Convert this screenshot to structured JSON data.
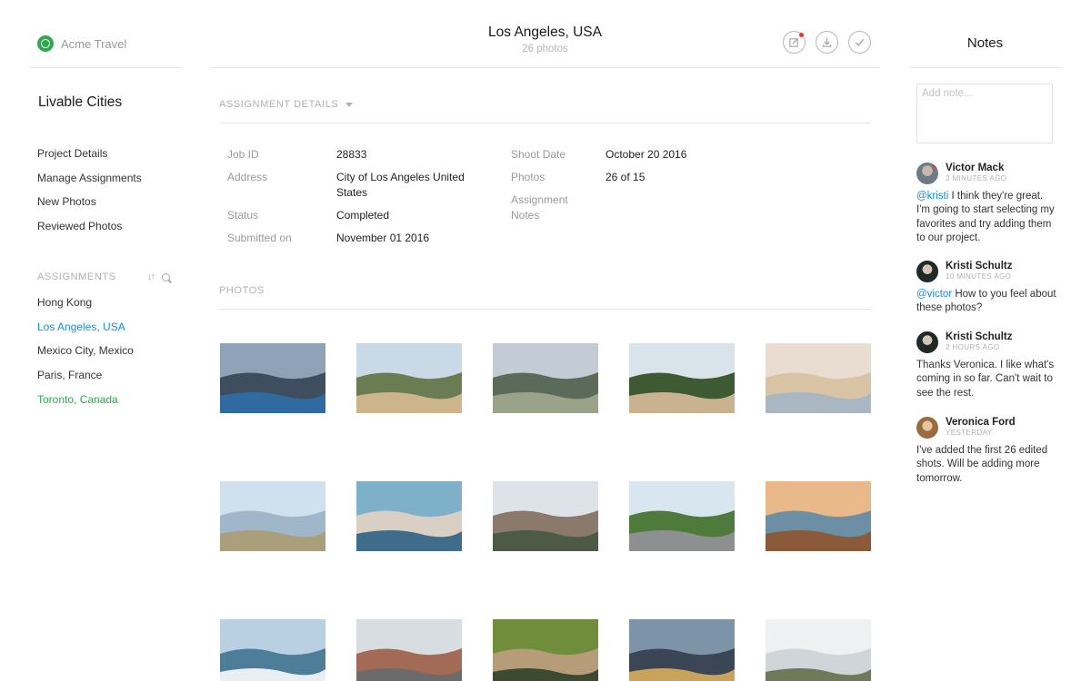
{
  "brand": {
    "name": "Acme Travel"
  },
  "sidebar": {
    "project_title": "Livable Cities",
    "nav": [
      "Project Details",
      "Manage Assignments",
      "New Photos",
      "Reviewed Photos"
    ],
    "assignments_label": "ASSIGNMENTS",
    "assignments": [
      "Hong Kong",
      "Los Angeles, USA",
      "Mexico City, Mexico",
      "Paris, France",
      "Toronto, Canada"
    ],
    "active_assignment": "Los Angeles, USA"
  },
  "header": {
    "title": "Los Angeles, USA",
    "subtitle": "26 photos",
    "actions": [
      "edit-icon",
      "download-icon",
      "checkmark-icon"
    ]
  },
  "details": {
    "section_label": "ASSIGNMENT DETAILS",
    "job_id_label": "Job ID",
    "job_id": "28833",
    "address_label": "Address",
    "address": "City of Los Angeles United States",
    "status_label": "Status",
    "status": "Completed",
    "submitted_label": "Submitted on",
    "submitted": "November 01 2016",
    "shoot_date_label": "Shoot Date",
    "shoot_date": "October 20 2016",
    "photos_label": "Photos",
    "photos": "26 of 15",
    "notes_label": "Assignment Notes",
    "notes": ""
  },
  "photos": {
    "section_label": "PHOTOS",
    "items": [
      "la-fence-view",
      "hills-overlook",
      "city-aerial",
      "bike-trail",
      "pier-beach",
      "beach-boardwalk",
      "friends-selfie",
      "street-shops",
      "palm-avenue",
      "coast-sunset",
      "pier-waves",
      "downtown-street",
      "garden-street",
      "highway-dusk",
      "white-villa"
    ]
  },
  "notes": {
    "title": "Notes",
    "placeholder": "Add note...",
    "comments": [
      {
        "author": "Victor Mack",
        "time": "3 MINUTES AGO",
        "mention": "@kristi",
        "text": " I think they're great. I'm going to start selecting my favorites and try adding them to our project."
      },
      {
        "author": "Kristi Schultz",
        "time": "10 MINUTES AGO",
        "mention": "@victor",
        "text": " How to you feel about these photos?"
      },
      {
        "author": "Kristi Schultz",
        "time": "2 HOURS AGO",
        "mention": "",
        "text": "Thanks Veronica. I like what's coming in so far. Can't wait to see the rest."
      },
      {
        "author": "Veronica Ford",
        "time": "YESTERDAY",
        "mention": "",
        "text": "I've added the first 26 edited shots. Will be adding more tomorrow."
      }
    ]
  },
  "colors": {
    "accent": "#1a8dd6",
    "green": "#2fa84f",
    "alert": "#e8372c"
  }
}
